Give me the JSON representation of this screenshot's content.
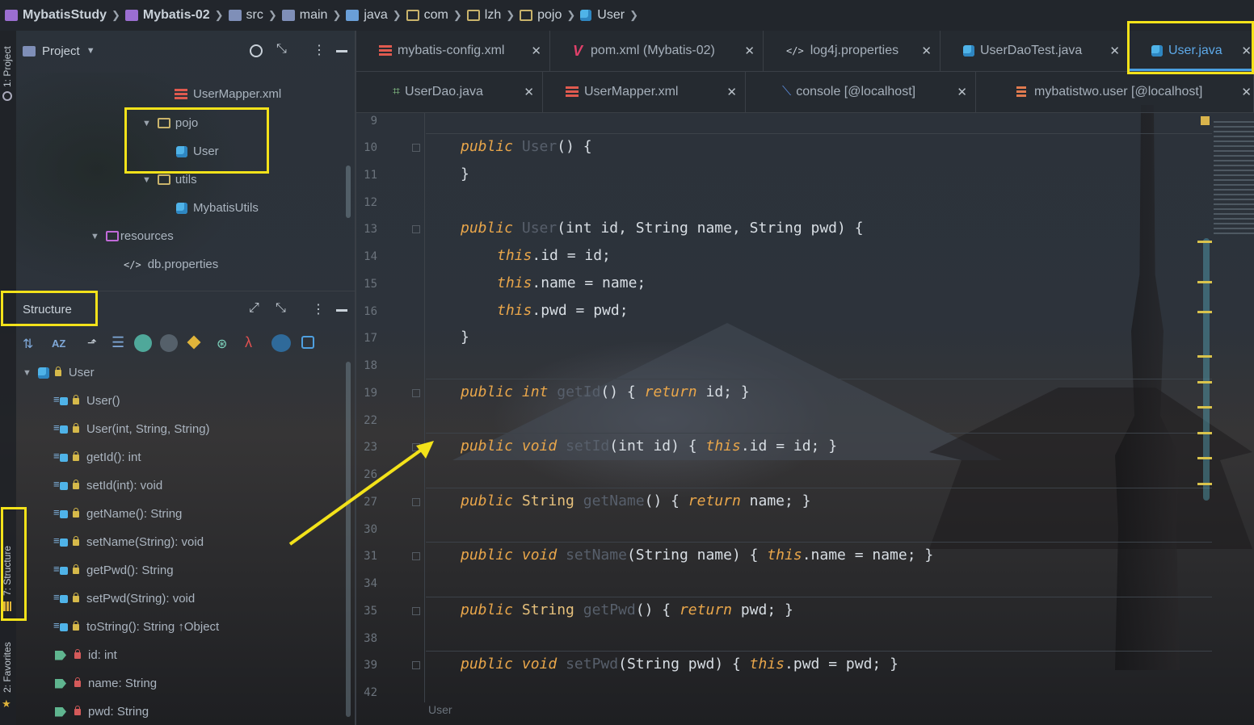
{
  "breadcrumb": {
    "items": [
      {
        "label": "MybatisStudy",
        "icon": "project-folder-icon"
      },
      {
        "label": "Mybatis-02",
        "icon": "module-folder-icon"
      },
      {
        "label": "src",
        "icon": "source-folder-icon"
      },
      {
        "label": "main",
        "icon": "folder-icon"
      },
      {
        "label": "java",
        "icon": "folder-icon"
      },
      {
        "label": "com",
        "icon": "package-icon"
      },
      {
        "label": "lzh",
        "icon": "package-icon"
      },
      {
        "label": "pojo",
        "icon": "package-icon"
      },
      {
        "label": "User",
        "icon": "class-icon"
      }
    ]
  },
  "strip": {
    "project_label": "1: Project",
    "structure_label": "7: Structure",
    "favorites_label": "2: Favorites"
  },
  "project_panel": {
    "title": "Project",
    "tree": [
      {
        "label": "UserMapper.xml",
        "type": "xml"
      },
      {
        "label": "pojo",
        "type": "package",
        "expanded": true
      },
      {
        "label": "User",
        "type": "class"
      },
      {
        "label": "utils",
        "type": "package",
        "expanded": true
      },
      {
        "label": "MybatisUtils",
        "type": "class"
      },
      {
        "label": "resources",
        "type": "resource-folder",
        "expanded": true
      },
      {
        "label": "db.properties",
        "type": "properties"
      }
    ]
  },
  "structure_panel": {
    "title": "Structure",
    "root": "User",
    "members": [
      {
        "label": "User()",
        "kind": "method"
      },
      {
        "label": "User(int, String, String)",
        "kind": "method"
      },
      {
        "label": "getId(): int",
        "kind": "method"
      },
      {
        "label": "setId(int): void",
        "kind": "method"
      },
      {
        "label": "getName(): String",
        "kind": "method"
      },
      {
        "label": "setName(String): void",
        "kind": "method"
      },
      {
        "label": "getPwd(): String",
        "kind": "method"
      },
      {
        "label": "setPwd(String): void",
        "kind": "method"
      },
      {
        "label": "toString(): String ↑Object",
        "kind": "method"
      },
      {
        "label": "id: int",
        "kind": "field"
      },
      {
        "label": "name: String",
        "kind": "field"
      },
      {
        "label": "pwd: String",
        "kind": "field"
      }
    ]
  },
  "tabs": {
    "row1": [
      {
        "label": "mybatis-config.xml",
        "icon": "xml-icon"
      },
      {
        "label": "pom.xml (Mybatis-02)",
        "icon": "maven-icon"
      },
      {
        "label": "log4j.properties",
        "icon": "properties-icon"
      },
      {
        "label": "UserDaoTest.java",
        "icon": "test-class-icon"
      },
      {
        "label": "User.java",
        "icon": "class-icon",
        "active": true
      }
    ],
    "row2": [
      {
        "label": "UserDao.java",
        "icon": "interface-icon"
      },
      {
        "label": "UserMapper.xml",
        "icon": "xml-icon"
      },
      {
        "label": "console [@localhost]",
        "icon": "console-icon"
      },
      {
        "label": "mybatistwo.user [@localhost]",
        "icon": "table-icon"
      }
    ]
  },
  "editor": {
    "line_numbers": [
      "9",
      "10",
      "11",
      "12",
      "13",
      "14",
      "15",
      "16",
      "17",
      "18",
      "19",
      "22",
      "23",
      "26",
      "27",
      "30",
      "31",
      "34",
      "35",
      "38",
      "39",
      "42"
    ],
    "code": {
      "l10": {
        "kw": "public",
        "name": "User",
        "rest": "() {"
      },
      "l11": "}",
      "l13": {
        "kw": "public",
        "name": "User",
        "rest": "(int id, String name, String pwd) {"
      },
      "l14": {
        "kw": "this",
        "rest": ".id = id;"
      },
      "l15": {
        "kw": "this",
        "rest": ".name = name;"
      },
      "l16": {
        "kw": "this",
        "rest": ".pwd = pwd;"
      },
      "l17": "}",
      "l19": {
        "kw": "public",
        "type": "int",
        "name": "getId",
        "body1": "() { ",
        "kw2": "return",
        "body2": " id; }"
      },
      "l23": {
        "kw": "public",
        "type": "void",
        "name": "setId",
        "body1": "(int id) { ",
        "kw2": "this",
        "body2": ".id = id; }"
      },
      "l27": {
        "kw": "public",
        "type": "String",
        "name": "getName",
        "body1": "() { ",
        "kw2": "return",
        "body2": " name; }"
      },
      "l31": {
        "kw": "public",
        "type": "void",
        "name": "setName",
        "body1": "(String name) { ",
        "kw2": "this",
        "body2": ".name = name; }"
      },
      "l35": {
        "kw": "public",
        "type": "String",
        "name": "getPwd",
        "body1": "() { ",
        "kw2": "return",
        "body2": " pwd; }"
      },
      "l39": {
        "kw": "public",
        "type": "void",
        "name": "setPwd",
        "body1": "(String pwd) { ",
        "kw2": "this",
        "body2": ".pwd = pwd; }"
      }
    },
    "footer_breadcrumb": "User"
  },
  "colors": {
    "highlight": "#f3e21a",
    "keyword": "#e9a64a",
    "active_tab": "#5da9e8"
  }
}
